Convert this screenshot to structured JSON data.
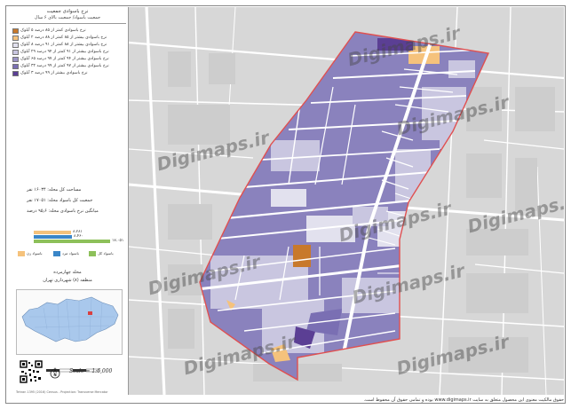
{
  "legend": {
    "title": "نرخ باسوادی جمعیت",
    "subtitle": "جمعیت باسواد/ جمعیت بالای ۶ سال",
    "items": [
      {
        "label": "نرخ باسوادی کمتر از ۸۵ درصد ۵ آبلوک",
        "color": "#c8792b"
      },
      {
        "label": "نرخ باسوادی بیشتر از ۸۵ کمتر از ۸۸ درصد ۲ آبلوک",
        "color": "#f5c27c"
      },
      {
        "label": "نرخ باسوادی بیشتر از ۸۸ کمتر از ۹۱ درصد ۸ آبلوک",
        "color": "#e2e1ee"
      },
      {
        "label": "نرخ باسوادی بیشتر از ۹۱ کمتر از ۹۴ درصد ۲۹ آبلوک",
        "color": "#c9c6e0"
      },
      {
        "label": "نرخ باسوادی بیشتر از ۹۴ کمتر از ۹۷ درصد ۶۵ آبلوک",
        "color": "#9a93c5"
      },
      {
        "label": "نرخ باسوادی بیشتر از ۹۷ کمتر از ۹۹ درصد ۳۲ آبلوک",
        "color": "#7a6fb3"
      },
      {
        "label": "نرخ باسوادی بیشتر از ۹۹ درصد ۳ آبلوک",
        "color": "#5b3f94"
      }
    ]
  },
  "stats": {
    "area": "مساحت کل محله: ۱۶۰۳۴ نفر",
    "population": "جمعیت کل باسواد محله: ۱۷۰۵۱ نفر",
    "rate": "میانگین نرخ باسوادی محله: ۹۵٫۶ درصد"
  },
  "bars": [
    {
      "value_label": "۸،۲۸۱",
      "value": 8281,
      "color": "#f5c27c"
    },
    {
      "value_label": "۸،۴۶۰",
      "value": 8460,
      "color": "#3a86c8"
    },
    {
      "value_label": "۱۷،۰۵۱",
      "value": 17051,
      "color": "#8dc05a"
    }
  ],
  "bar_keys": [
    {
      "label": "باسواد زن",
      "color": "#f5c27c"
    },
    {
      "label": "باسواد مرد",
      "color": "#3a86c8"
    },
    {
      "label": "باسواد کل",
      "color": "#8dc05a"
    }
  ],
  "location": {
    "heading": "محله چهارمرده",
    "region": "منطقه (۸) شهرداری تهران"
  },
  "scale": {
    "text": "Scale = 1:6,000"
  },
  "credit": "Tehran 1395 (2016) Census - Projection: Transverse Mercator",
  "footer": "حقوق مالکیت معنوی این محصول متعلق به سایت www.digimaps.ir بوده و تمامی حقوق آن محفوظ است.",
  "watermark": "Digimaps.ir",
  "colors": {
    "neighborhood_border": "#e05050",
    "background_map": "#d7d7d7",
    "street": "#ffffff"
  }
}
